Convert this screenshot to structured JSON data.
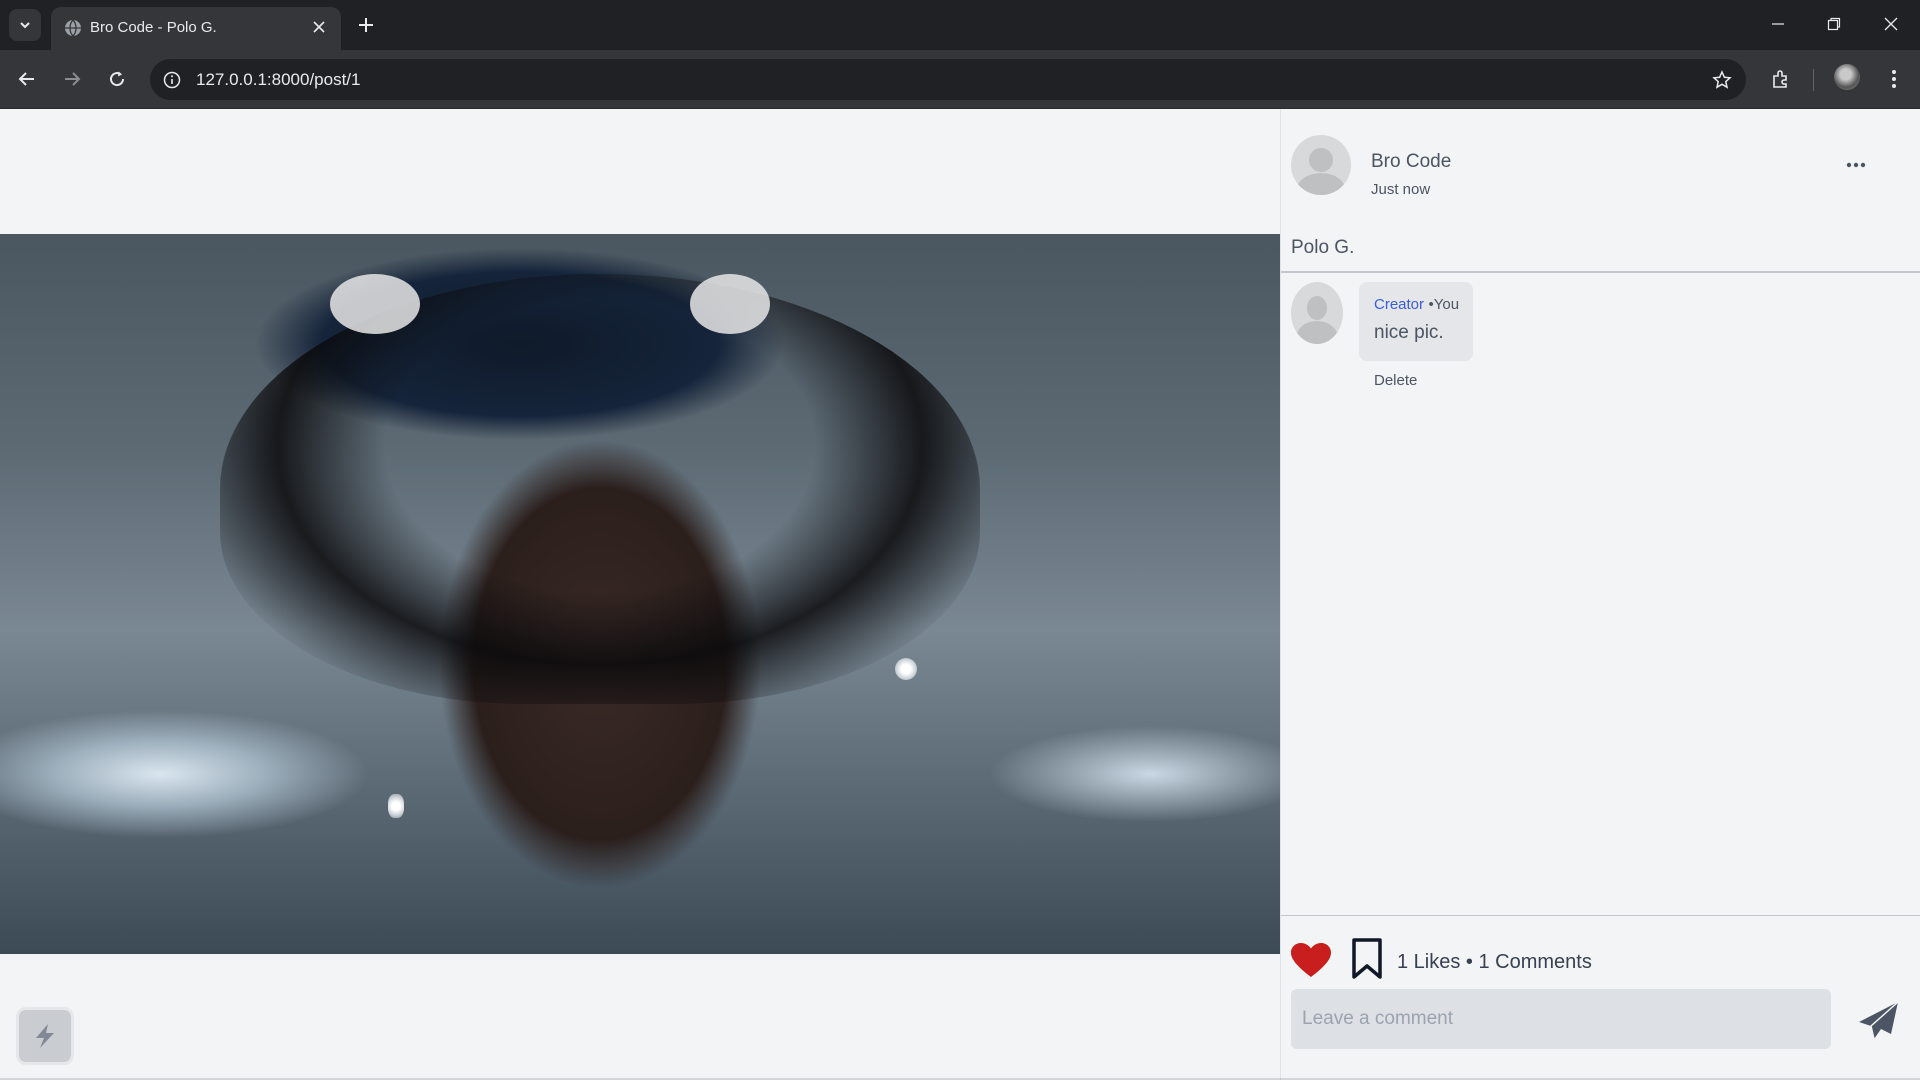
{
  "browser": {
    "tab_title": "Bro Code - Polo G.",
    "url": "127.0.0.1:8000/post/1",
    "icons": [
      "tab-list-icon",
      "globe-icon",
      "close-icon",
      "plus-icon",
      "minimize-icon",
      "restore-icon",
      "close-window-icon",
      "back-icon",
      "forward-icon",
      "reload-icon",
      "info-icon",
      "star-icon",
      "extensions-icon",
      "menu-dots-icon"
    ]
  },
  "post": {
    "author": "Bro Code",
    "time": "Just now",
    "caption": "Polo G.",
    "more_icon": "ellipsis-icon"
  },
  "comments": [
    {
      "name": "Creator",
      "you_label": "•You",
      "text": "nice pic.",
      "delete_label": "Delete"
    }
  ],
  "actions": {
    "stats": "1 Likes • 1 Comments",
    "like_icon": "heart-icon",
    "bookmark_icon": "bookmark-icon",
    "liked": true,
    "like_color": "#c81e1e"
  },
  "comment_box": {
    "placeholder": "Leave a comment",
    "send_icon": "paper-plane-icon"
  },
  "colors": {
    "chrome_dark": "#202124",
    "chrome_toolbar": "#35363a",
    "page_bg": "#f3f4f6",
    "link_blue": "#3b5bdb"
  }
}
